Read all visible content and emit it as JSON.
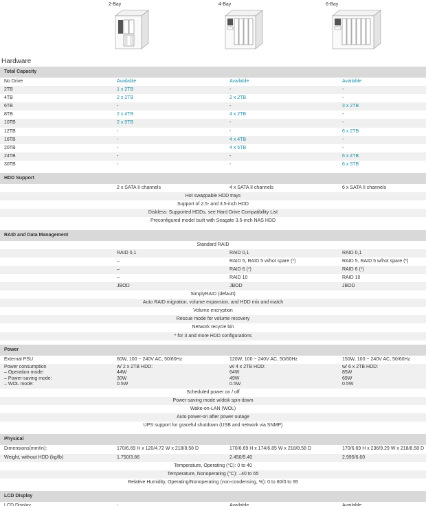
{
  "products": [
    {
      "name": "2-Bay",
      "bays": 2
    },
    {
      "name": "4-Bay",
      "bays": 4
    },
    {
      "name": "6-Bay",
      "bays": 6
    }
  ],
  "heading": "Hardware",
  "sections": [
    {
      "title": "Total Capacity",
      "rows": [
        {
          "cells": [
            "No Drive",
            "Available",
            "Available",
            "Available"
          ],
          "links": [
            1,
            2,
            3
          ]
        },
        {
          "cells": [
            "2TB",
            "1 x 2TB",
            "-",
            "-"
          ],
          "links": [
            1
          ]
        },
        {
          "cells": [
            "4TB",
            "2 x 2TB",
            "2 x 2TB",
            "-"
          ],
          "links": [
            1,
            2
          ]
        },
        {
          "cells": [
            "6TB",
            "-",
            "-",
            "3 x 2TB"
          ],
          "links": [
            3
          ]
        },
        {
          "cells": [
            "8TB",
            "2 x 4TB",
            "4 x 2TB",
            "-"
          ],
          "links": [
            1,
            2
          ]
        },
        {
          "cells": [
            "10TB",
            "2 x 5TB",
            "-",
            "-"
          ],
          "links": [
            1
          ]
        },
        {
          "cells": [
            "12TB",
            "-",
            "-",
            "6 x 2TB"
          ],
          "links": [
            3
          ]
        },
        {
          "cells": [
            "16TB",
            "-",
            "4 x 4TB",
            "-"
          ],
          "links": [
            2
          ]
        },
        {
          "cells": [
            "20TB",
            "-",
            "4 x 5TB",
            "-"
          ],
          "links": [
            2
          ]
        },
        {
          "cells": [
            "24TB",
            "-",
            "-",
            "6 x 4TB"
          ],
          "links": [
            3
          ]
        },
        {
          "cells": [
            "30TB",
            "-",
            "-",
            "6 x 5TB"
          ],
          "links": [
            3
          ]
        }
      ]
    },
    {
      "title": "HDD Support",
      "rows": [
        {
          "cells": [
            "",
            "2 x SATA II channels",
            "4 x SATA II channels",
            "6 x SATA II channels"
          ]
        },
        {
          "span": "Hot swappable HDD trays"
        },
        {
          "span": "Support of 2.5- and 3.5-inch HDD"
        },
        {
          "span": "Diskless: Supported HDDs, see Hard Drive Compatibility List"
        },
        {
          "span": "Preconfigured model built with Seagate 3.5-inch NAS HDD"
        }
      ]
    },
    {
      "title": "RAID and Data Management",
      "rows": [
        {
          "span": "Standard RAID"
        },
        {
          "cells": [
            "",
            "RAID 0,1",
            "RAID 0,1",
            "RAID 0,1"
          ]
        },
        {
          "cells": [
            "",
            "–",
            "RAID 5, RAID 5 w/hot spare (*)",
            "RAID 5, RAID 5 w/hot spare (*)"
          ]
        },
        {
          "cells": [
            "",
            "–",
            "RAID 6 (*)",
            "RAID 6 (*)"
          ]
        },
        {
          "cells": [
            "",
            "–",
            "RAID 10",
            "RAID 10"
          ]
        },
        {
          "cells": [
            "",
            "JBOD",
            "JBOD",
            "JBOD"
          ]
        },
        {
          "span": "SimplyRAID (default)"
        },
        {
          "span": "Auto RAID migration, volume expansion, and HDD mix and match"
        },
        {
          "span": "Volume encryption"
        },
        {
          "span": "Rescue mode for volume recovery"
        },
        {
          "span": "Network recycle bin"
        },
        {
          "span": "* for 3 and more HDD configurations"
        }
      ]
    },
    {
      "title": "Power",
      "rows": [
        {
          "cells": [
            "External PSU",
            "60W, 100 ~ 240V AC, 50/60Hz",
            "120W, 100 ~ 240V AC, 50/60Hz",
            "150W, 100 ~ 240V AC, 50/60Hz"
          ]
        },
        {
          "multi": [
            [
              "Power consumption",
              "– Operation mode:",
              "– Power-saving mode:",
              "– WOL mode:"
            ],
            [
              "w/ 2 x 2TB HDD:",
              "44W",
              "30W",
              "0.5W"
            ],
            [
              "w/ 4 x 2TB HDD:",
              "64W",
              "49W",
              "0.5W"
            ],
            [
              "w/ 6 x 2TB HDD:",
              "85W",
              "69W",
              "0.5W"
            ]
          ]
        },
        {
          "span": "Scheduled power on / off"
        },
        {
          "span": "Power-saving mode w/disk spin-down"
        },
        {
          "span": "Wake-on-LAN (WOL)"
        },
        {
          "span": "Auto power-on after power outage"
        },
        {
          "span": "UPS support for graceful shutdown (USB and network via SNMP)"
        }
      ]
    },
    {
      "title": "Physical",
      "rows": [
        {
          "cells": [
            "Dimensions(mm/in):",
            "170/6.69 H x 120/4.72 W x 218/8.58 D",
            "170/6.69 H x 174/6.85 W x 218/8.58 D",
            "170/6.69 H x 236/9.29 W x 218/8.58 D"
          ]
        },
        {
          "cells": [
            "Weight, without HDD (kg/lb)",
            "1.750/3.86",
            "2.450/5.40",
            "2.995/6.60"
          ]
        },
        {
          "span": "Temperature, Operating (°C): 0 to 40"
        },
        {
          "span": "Temperature, Nonoperating (°C): –40 to 65"
        },
        {
          "span": "Relative Humidity, Operating/Nonoperating (non-condensing, %): 0 to 80/0 to 95"
        }
      ]
    },
    {
      "title": "LCD Display",
      "rows": [
        {
          "cells": [
            "LCD Display",
            "-",
            "Available",
            "Available"
          ]
        }
      ]
    }
  ]
}
